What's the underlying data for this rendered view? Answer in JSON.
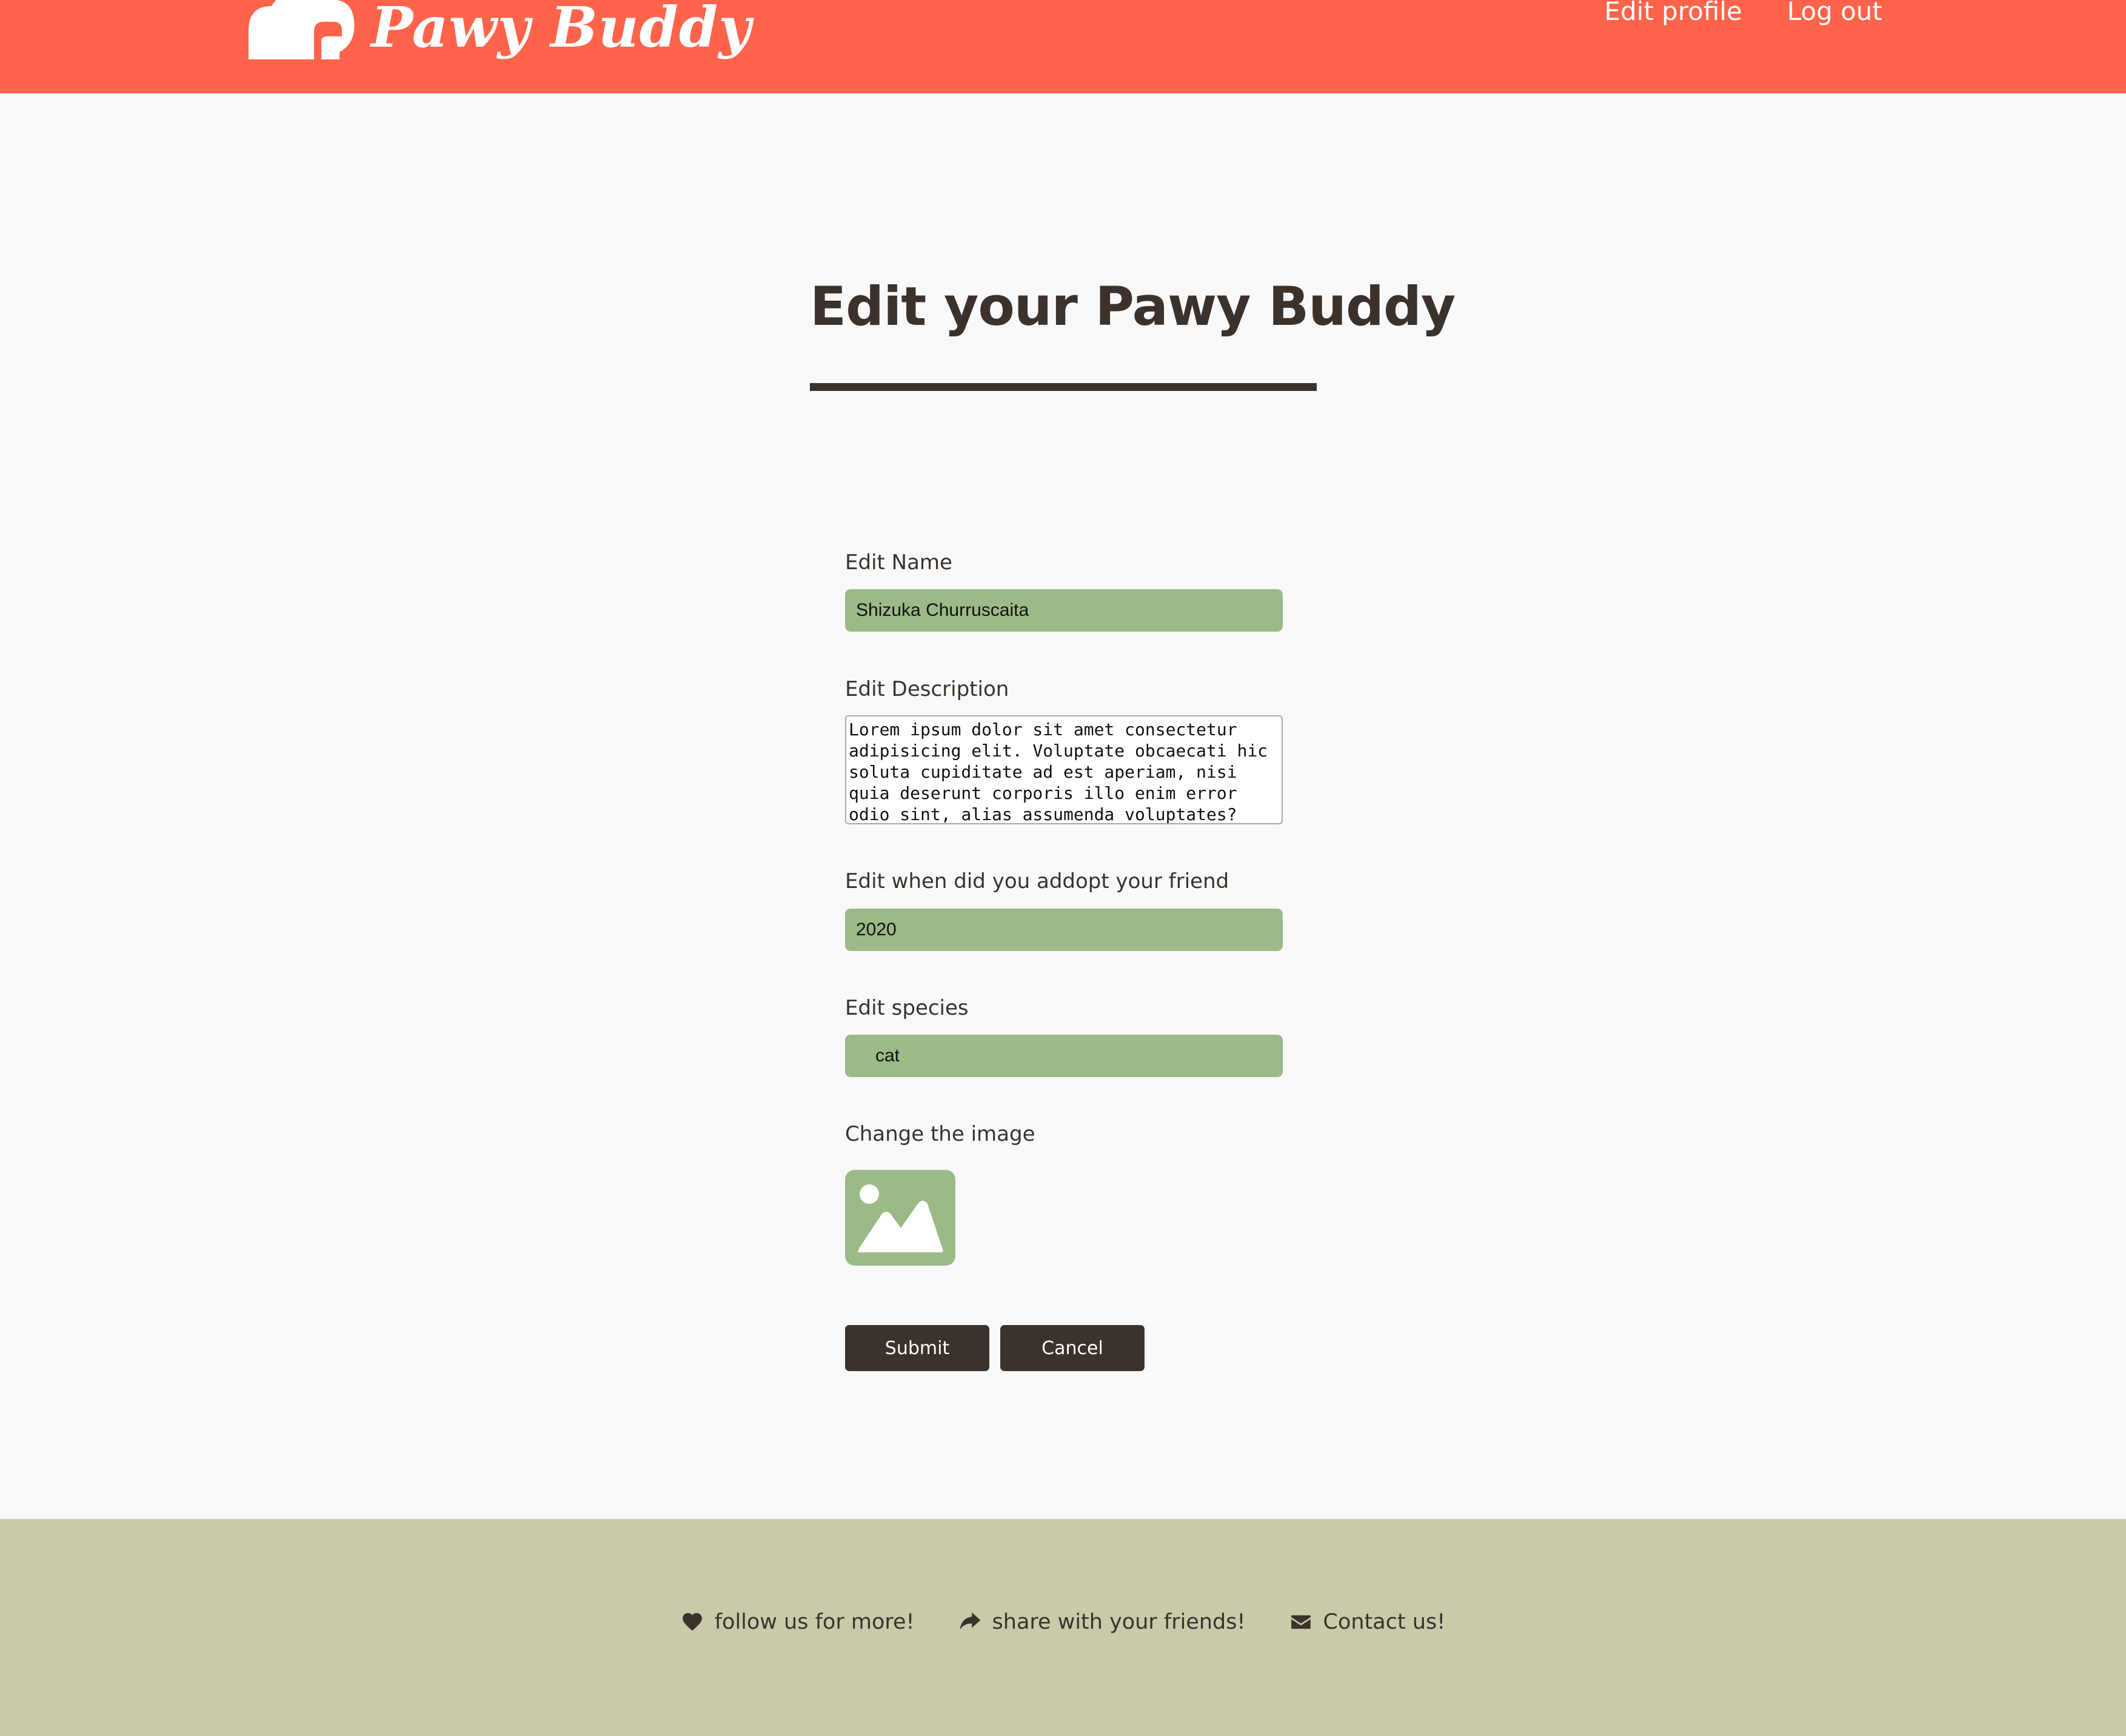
{
  "colors": {
    "header": "#ff634a",
    "background": "#f9f9f9",
    "accent_green": "#9bba88",
    "dark": "#3a322b",
    "footer": "#c9caaa"
  },
  "header": {
    "logo_text": "Pawy Buddy",
    "logo_icon": "paw-cloud-icon",
    "nav": [
      {
        "label": "Edit profile"
      },
      {
        "label": "Log out"
      }
    ]
  },
  "page": {
    "title": "Edit your Pawy Buddy"
  },
  "form": {
    "name": {
      "label": "Edit Name",
      "value": "Shizuka Churruscaita"
    },
    "description": {
      "label": "Edit Description",
      "value": "Lorem ipsum dolor sit amet consectetur adipisicing elit. Voluptate obcaecati hic soluta cupiditate ad est aperiam, nisi quia deserunt corporis illo enim error odio sint, alias assumenda voluptates?"
    },
    "adopted": {
      "label": "Edit when did you addopt your friend",
      "value": "2020"
    },
    "species": {
      "label": "Edit species",
      "value": "cat"
    },
    "image": {
      "label": "Change the image",
      "icon": "image-placeholder-icon"
    },
    "submit_label": "Submit",
    "cancel_label": "Cancel"
  },
  "footer": {
    "links": [
      {
        "label": "follow us for more!",
        "icon": "heart-icon"
      },
      {
        "label": "share with your friends!",
        "icon": "share-icon"
      },
      {
        "label": "Contact us!",
        "icon": "envelope-icon"
      }
    ]
  }
}
